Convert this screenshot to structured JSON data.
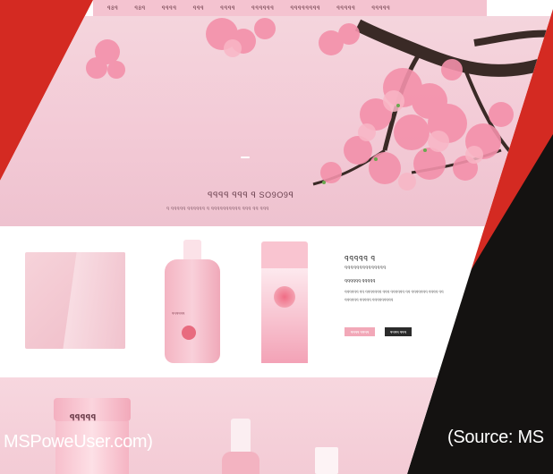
{
  "nav": {
    "items": [
      "ꟼ8ꟼ",
      "ꟼ8ꟼ",
      "ꟼꟼꟼꟼ",
      "ꟼꟼꟼ",
      "ꟼꟼꟼꟼ",
      "ꟼꟼꟼꟼꟼꟼ",
      "ꟼꟼꟼꟼꟼꟼꟼꟼ",
      "ꟼꟼꟼꟼꟼ",
      "ꟼꟼꟼꟼꟼ"
    ]
  },
  "hero": {
    "title": "ꟼꟼꟼꟼ ꟼꟼꟼ ꟼ SO9O9ꟼ",
    "subtitle": "ꟼ ꟼꟼꟼꟼꟼ ꟼꟼꟼꟼꟼꟼ ꟼ ꟼꟼꟼꟼꟼꟼꟼꟼꟼꟼ ꟼꟼꟼ ꟼꟼ ꟼꟼꟼ"
  },
  "products": {
    "bottle_label": "ꟼꟼꟼꟼꟼꟼ",
    "info": {
      "title": "ꟼꟼꟼꟼꟼ ꟼ",
      "subtitle": "ꟼꟼꟼꟼꟼꟼꟼꟼꟼꟼꟼꟼꟼꟼ",
      "heading": "ꟼꟼꟼꟼꟼꟼ ꟼꟼꟼꟼꟼ",
      "body": "ꟼꟼꟼꟼꟼꟼ ꟼꟼ ꟼꟼꟼꟼꟼꟼꟼ ꟼꟼꟼ ꟼꟼꟼꟼꟼꟼ ꟼꟼ ꟼꟼꟼꟼꟼꟼꟼ ꟼꟼꟼꟼ ꟼꟼ ꟼꟼꟼꟼꟼꟼ ꟼꟼꟼꟼꟼ ꟼꟼꟼꟼꟼꟼꟼꟼꟼ",
      "primary_button": "ꟼꟼꟼꟼ ꟼꟼꟼꟼ",
      "secondary_button": "ꟼꟼꟼꟼ ꟼꟼꟼ"
    }
  },
  "bottom": {
    "tub_label": "ꟼꟼꟼꟼꟼ"
  },
  "captions": {
    "left": "MSPoweUser.com)",
    "right": "(Source: MS"
  },
  "colors": {
    "red": "#d42a22",
    "black": "#141211",
    "pink_nav": "#f4c3d0",
    "hero_pink": "#f3cad6",
    "blossom": "#f390aa",
    "branch": "#3a2a26"
  }
}
